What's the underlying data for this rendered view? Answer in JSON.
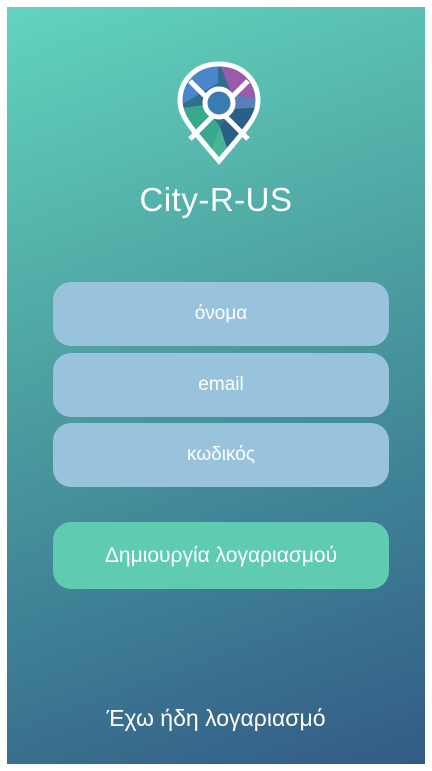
{
  "app": {
    "title": "City-R-US",
    "logo_icon": "map-pin-logo-icon"
  },
  "form": {
    "name_placeholder": "όνομα",
    "email_placeholder": "email",
    "password_placeholder": "κωδικός",
    "create_account_label": "Δημιουργία λογαριασμού"
  },
  "footer": {
    "login_link": "Έχω ήδη λογαριασμό"
  },
  "colors": {
    "gradient_top": "#62d4bf",
    "gradient_bottom": "#335a86",
    "input_bg": "#99c3dc",
    "button_bg": "#5fcbb0",
    "text": "#ffffff"
  }
}
